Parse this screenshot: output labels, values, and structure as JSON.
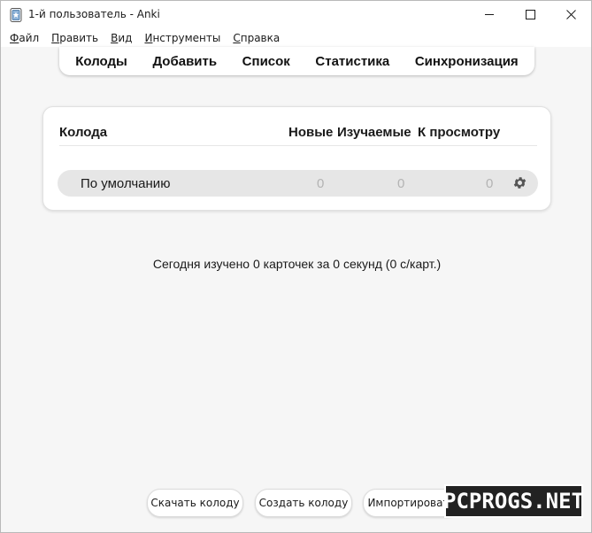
{
  "window": {
    "title": "1-й пользователь - Anki",
    "icon": "anki-star-icon"
  },
  "menu": {
    "items": [
      {
        "label_u": "Ф",
        "label_rest": "айл"
      },
      {
        "label_u": "П",
        "label_rest": "равить"
      },
      {
        "label_u": "В",
        "label_rest": "ид"
      },
      {
        "label_u": "И",
        "label_rest": "нструменты"
      },
      {
        "label_u": "С",
        "label_rest": "правка"
      }
    ]
  },
  "toolbar": {
    "decks": "Колоды",
    "add": "Добавить",
    "browse": "Список",
    "stats": "Статистика",
    "sync": "Синхронизация"
  },
  "deck_table": {
    "headers": {
      "deck": "Колода",
      "new": "Новые",
      "learn": "Изучаемые",
      "review": "К просмотру"
    },
    "rows": [
      {
        "name": "По умолчанию",
        "new": "0",
        "learn": "0",
        "review": "0"
      }
    ]
  },
  "study_stats": "Сегодня изучено 0 карточек за 0 секунд (0 с/карт.)",
  "buttons": {
    "download": "Скачать колоду",
    "create": "Создать колоду",
    "import": "Импортировать"
  },
  "watermark": "PCPROGS.NET",
  "colors": {
    "background": "#f6f6f6",
    "row_highlight": "#e6e6e6",
    "count_zero": "#b3b3b3"
  }
}
